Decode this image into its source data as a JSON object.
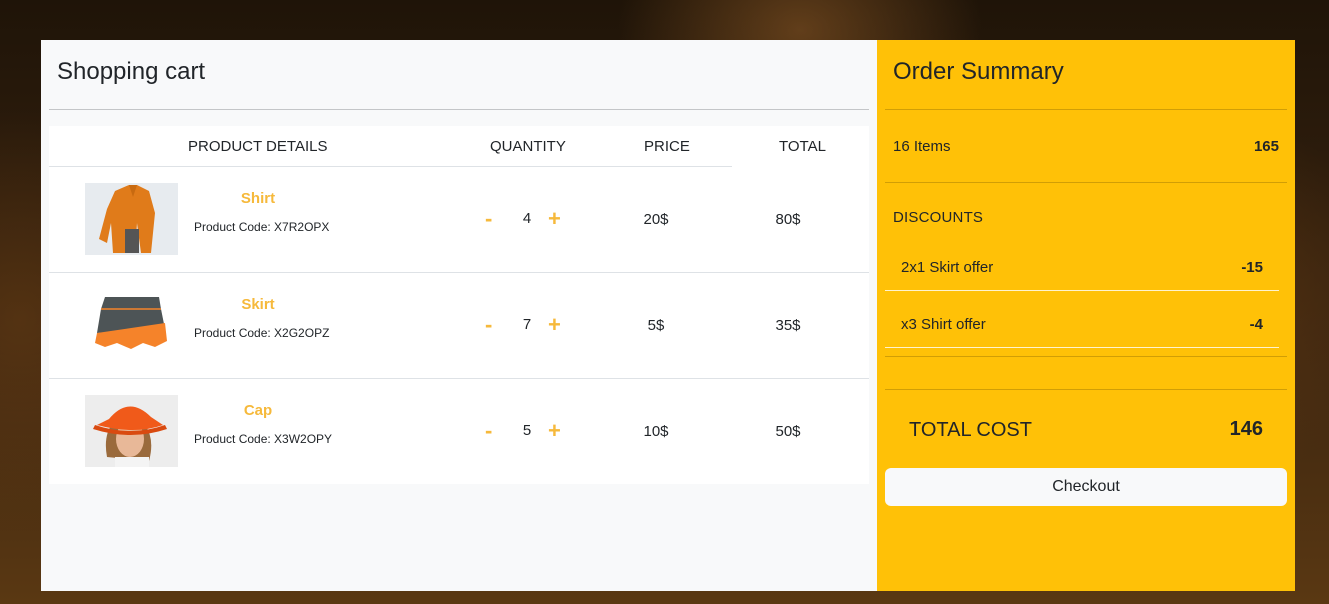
{
  "cart": {
    "title": "Shopping cart",
    "columns": {
      "product": "PRODUCT DETAILS",
      "quantity": "QUANTITY",
      "price": "PRICE",
      "total": "TOTAL"
    },
    "items": [
      {
        "name": "Shirt",
        "code": "Product Code: X7R2OPX",
        "minus": "-",
        "qty": "4",
        "plus": "+",
        "price": "20$",
        "total": "80$"
      },
      {
        "name": "Skirt",
        "code": "Product Code: X2G2OPZ",
        "minus": "-",
        "qty": "7",
        "plus": "+",
        "price": "5$",
        "total": "35$"
      },
      {
        "name": "Cap",
        "code": "Product Code: X3W2OPY",
        "minus": "-",
        "qty": "5",
        "plus": "+",
        "price": "10$",
        "total": "50$"
      }
    ]
  },
  "summary": {
    "title": "Order Summary",
    "items_label": "16  Items",
    "items_value": "165",
    "discounts_title": "DISCOUNTS",
    "discounts": [
      {
        "label": "2x1 Skirt offer",
        "value": "-15"
      },
      {
        "label": "x3 Shirt offer",
        "value": "-4"
      }
    ],
    "total_label": "TOTAL COST",
    "total_value": "146",
    "checkout_label": "Checkout"
  },
  "colors": {
    "accent": "#ffc107",
    "product_name": "#f6b93b",
    "panel": "#f8f9fa"
  }
}
